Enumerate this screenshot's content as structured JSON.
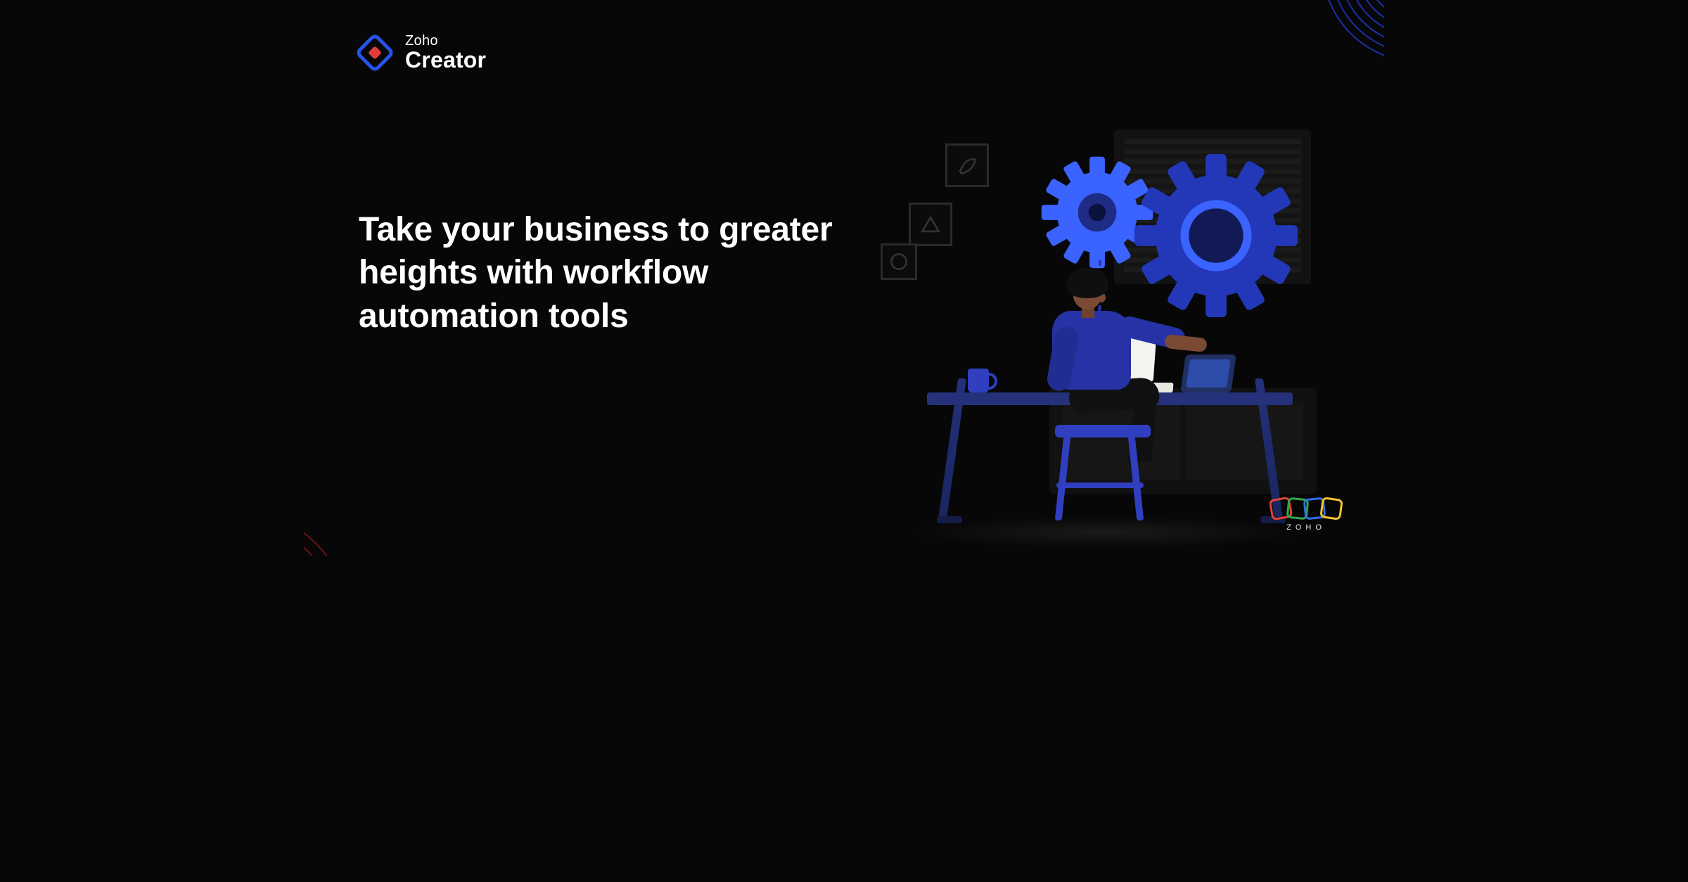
{
  "logo": {
    "line1": "Zoho",
    "line2": "Creator"
  },
  "headline": "Take your business to greater heights with workflow automation tools",
  "footer": {
    "brand": "ZOHO"
  },
  "colors": {
    "brand_blue": "#2853e8",
    "brand_red": "#e23b3b",
    "gear_light": "#3a63ff",
    "gear_dark": "#2338b8",
    "desk": "#25317a",
    "shirt": "#2632a6"
  }
}
